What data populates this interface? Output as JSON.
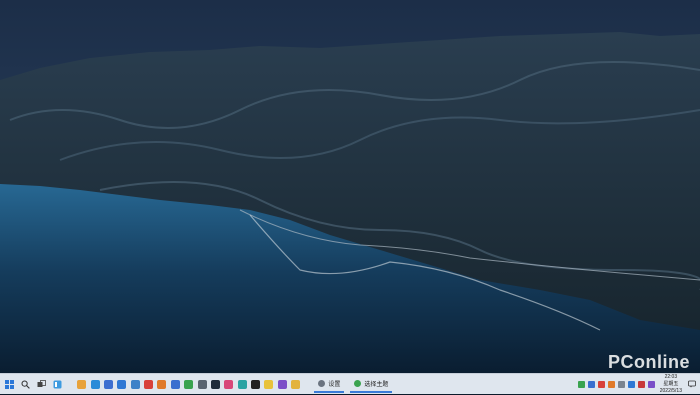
{
  "desktop": {
    "watermark": "PConline"
  },
  "taskbar": {
    "start_icon": "windows-start-icon",
    "search_icon": "search-icon",
    "taskview_icon": "task-view-icon",
    "widgets_icon": "widgets-icon",
    "pinned_apps": [
      {
        "name": "chrome-icon",
        "color": "#e8a23a"
      },
      {
        "name": "edge-icon",
        "color": "#2a8bd8"
      },
      {
        "name": "store-icon",
        "color": "#3d6fd0"
      },
      {
        "name": "mail-icon",
        "color": "#2f78d4"
      },
      {
        "name": "photos-icon",
        "color": "#3e82c8"
      },
      {
        "name": "app-red-icon",
        "color": "#d8413a"
      },
      {
        "name": "app-orange-icon",
        "color": "#e07a2a"
      },
      {
        "name": "app-blue-icon",
        "color": "#3a6fcf"
      },
      {
        "name": "app-green-icon",
        "color": "#3aa34f"
      },
      {
        "name": "app-gray-icon",
        "color": "#5a6470"
      },
      {
        "name": "app-dark-icon",
        "color": "#1f2b3a"
      },
      {
        "name": "app-pink-icon",
        "color": "#d8487a"
      },
      {
        "name": "app-teal-icon",
        "color": "#2aa3a3"
      },
      {
        "name": "app-black-icon",
        "color": "#222222"
      },
      {
        "name": "app-yellow-icon",
        "color": "#e8c23a"
      },
      {
        "name": "app-purple-icon",
        "color": "#7a4fc8"
      },
      {
        "name": "folder-icon",
        "color": "#e3b33e"
      }
    ],
    "windows": [
      {
        "label": "设置",
        "icon": "settings-icon",
        "color": "#6b7480"
      },
      {
        "label": "选择主题",
        "icon": "paint-icon",
        "color": "#3aa34f"
      }
    ],
    "tray_icons": [
      {
        "name": "tray-green-icon",
        "color": "#3aa34f"
      },
      {
        "name": "tray-blue-icon",
        "color": "#3a6fcf"
      },
      {
        "name": "tray-red-icon",
        "color": "#d8413a"
      },
      {
        "name": "tray-orange-icon",
        "color": "#e07a2a"
      },
      {
        "name": "tray-gray-icon",
        "color": "#7a8490"
      },
      {
        "name": "tray-blue2-icon",
        "color": "#2f78d4"
      },
      {
        "name": "tray-red2-icon",
        "color": "#c83a3a"
      },
      {
        "name": "tray-purple-icon",
        "color": "#7a4fc8"
      }
    ],
    "clock": {
      "time": "22:03",
      "weekday": "星期五",
      "date": "2022/5/13"
    },
    "notification_icon": "notification-icon"
  }
}
